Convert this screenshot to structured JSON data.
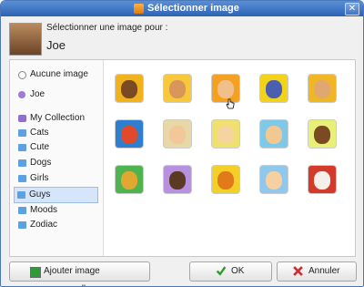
{
  "window": {
    "title": "Sélectionner image",
    "close_glyph": "✕"
  },
  "header": {
    "select_label": "Sélectionner une image pour :",
    "user_name": "Joe"
  },
  "sidebar": {
    "items": [
      {
        "label": "Aucune image",
        "icon": "none-icon",
        "selected": false
      },
      {
        "label": "Joe",
        "icon": "user-icon",
        "selected": false
      },
      {
        "label": "My Collection",
        "icon": "collection-icon",
        "selected": false
      },
      {
        "label": "Cats",
        "icon": "folder-icon",
        "selected": false
      },
      {
        "label": "Cute",
        "icon": "folder-icon",
        "selected": false
      },
      {
        "label": "Dogs",
        "icon": "folder-icon",
        "selected": false
      },
      {
        "label": "Girls",
        "icon": "folder-icon",
        "selected": false
      },
      {
        "label": "Guys",
        "icon": "folder-icon",
        "selected": true
      },
      {
        "label": "Moods",
        "icon": "folder-icon",
        "selected": false
      },
      {
        "label": "Zodiac",
        "icon": "folder-icon",
        "selected": false
      }
    ]
  },
  "avatars": [
    {
      "name": "guy-avatar-1",
      "bg": "#f2b21b",
      "face": "#7a4a22"
    },
    {
      "name": "guy-avatar-2",
      "bg": "#f7c93a",
      "face": "#d8965a"
    },
    {
      "name": "guy-avatar-3",
      "bg": "#f4a020",
      "face": "#f1c08a"
    },
    {
      "name": "guy-avatar-4",
      "bg": "#f3d21a",
      "face": "#4a5fb0"
    },
    {
      "name": "guy-avatar-5",
      "bg": "#f0b624",
      "face": "#e0a870"
    },
    {
      "name": "guy-avatar-6",
      "bg": "#2f7fd0",
      "face": "#e04a2a"
    },
    {
      "name": "guy-avatar-7",
      "bg": "#e8d8a8",
      "face": "#f2c89a"
    },
    {
      "name": "guy-avatar-8",
      "bg": "#f0e070",
      "face": "#f6d4a0"
    },
    {
      "name": "guy-avatar-9",
      "bg": "#7fc8e8",
      "face": "#f2c892"
    },
    {
      "name": "guy-avatar-10",
      "bg": "#e8f078",
      "face": "#7a4a22"
    },
    {
      "name": "guy-avatar-11",
      "bg": "#4fb34f",
      "face": "#e0a830"
    },
    {
      "name": "guy-avatar-12",
      "bg": "#b890e0",
      "face": "#5a3a22"
    },
    {
      "name": "guy-avatar-13",
      "bg": "#f2d028",
      "face": "#e07a1a"
    },
    {
      "name": "guy-avatar-14",
      "bg": "#8fc8ec",
      "face": "#f6d0a0"
    },
    {
      "name": "guy-avatar-15",
      "bg": "#d43a2a",
      "face": "#f4efe8"
    }
  ],
  "footer": {
    "add_label": "Ajouter image personnelle",
    "ok_label": "OK",
    "cancel_label": "Annuler"
  },
  "colors": {
    "titlebar": "#2d62b4",
    "selection": "#d6e6fa",
    "ok_check": "#2e9a2e",
    "cancel_x": "#d42a2a"
  }
}
